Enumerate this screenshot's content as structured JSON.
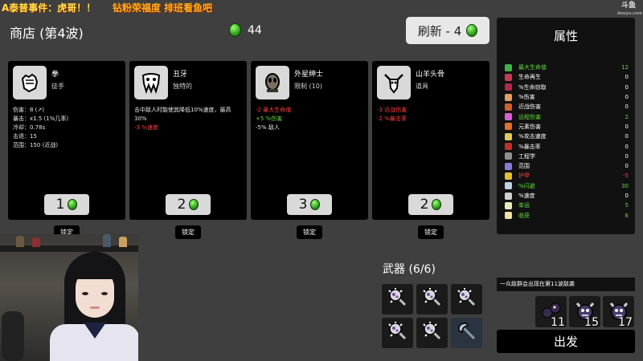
{
  "marquee": {
    "line1": "A泰普事件：虎哥！！",
    "line2": "钻粉荣福度 排班看鱼吧"
  },
  "watermark": {
    "logo": "斗鱼",
    "sub": "douyu.com"
  },
  "shop": {
    "title": "商店 (第4波)",
    "materials": "44"
  },
  "refresh": {
    "label": "刷新 - 4"
  },
  "cards": [
    {
      "name": "拳",
      "type": "徒手",
      "icon": "fist-icon",
      "stats": [
        {
          "text": "伤害：8 (↗)",
          "color": "w"
        },
        {
          "text": "暴击：x1.5 (1%几率)",
          "color": "w"
        },
        {
          "text": "冷却：0.78s",
          "color": "w"
        },
        {
          "text": "击退：15",
          "color": "w"
        },
        {
          "text": "范围：150 (近战)",
          "color": "w"
        }
      ],
      "price": "1",
      "lock": "锁定"
    },
    {
      "name": "丑牙",
      "type": "独特的",
      "icon": "ugly-tooth-icon",
      "stats": [
        {
          "text": "击中敌人时能使其降低10%速度，最高30%",
          "color": "w"
        },
        {
          "text": "-3 %速度",
          "color": "r"
        }
      ],
      "price": "2",
      "lock": "锁定"
    },
    {
      "name": "外星绅士",
      "type": "限制 (10)",
      "icon": "alien-gentleman-icon",
      "stats": [
        {
          "text": "-2 最大生命值",
          "color": "r"
        },
        {
          "text": "+5 %伤害",
          "color": "g"
        },
        {
          "text": "-5% 敌人",
          "color": "w"
        }
      ],
      "price": "3",
      "lock": "锁定"
    },
    {
      "name": "山羊头骨",
      "type": "道具",
      "icon": "goat-skull-icon",
      "stats": [
        {
          "text": "-3 近战伤害",
          "color": "r"
        },
        {
          "text": "-2 %暴击率",
          "color": "r"
        }
      ],
      "price": "2",
      "lock": "锁定"
    }
  ],
  "attributes": {
    "title": "属性",
    "rows": [
      {
        "label": "最大生命值",
        "value": "12",
        "highlight": "#5fdc3a",
        "icon_color": "#3fb34a"
      },
      {
        "label": "生命再生",
        "value": "0",
        "highlight": "#ffffff",
        "icon_color": "#c93a50"
      },
      {
        "label": "%生命窃取",
        "value": "0",
        "highlight": "#ffffff",
        "icon_color": "#b0284a"
      },
      {
        "label": "%伤害",
        "value": "0",
        "highlight": "#ffffff",
        "icon_color": "#e0a060"
      },
      {
        "label": "近战伤害",
        "value": "0",
        "highlight": "#ffffff",
        "icon_color": "#d06030"
      },
      {
        "label": "远程伤害",
        "value": "2",
        "highlight": "#5fdc3a",
        "icon_color": "#d55fd5"
      },
      {
        "label": "元素伤害",
        "value": "0",
        "highlight": "#ffffff",
        "icon_color": "#e07030"
      },
      {
        "label": "%攻击速度",
        "value": "0",
        "highlight": "#ffffff",
        "icon_color": "#e0c860"
      },
      {
        "label": "%暴击率",
        "value": "0",
        "highlight": "#ffffff",
        "icon_color": "#c03030"
      },
      {
        "label": "工程学",
        "value": "0",
        "highlight": "#ffffff",
        "icon_color": "#909090"
      },
      {
        "label": "范围",
        "value": "0",
        "highlight": "#ffffff",
        "icon_color": "#8a7ad8"
      },
      {
        "label": "护甲",
        "value": "-5",
        "highlight": "#ff4040",
        "icon_color": "#e0c030"
      },
      {
        "label": "%闪避",
        "value": "30",
        "highlight": "#5fdc3a",
        "icon_color": "#c0d0e0"
      },
      {
        "label": "%速度",
        "value": "0",
        "highlight": "#ffffff",
        "icon_color": "#d0d0d0"
      },
      {
        "label": "幸运",
        "value": "5",
        "highlight": "#5fdc3a",
        "icon_color": "#e8e8c0"
      },
      {
        "label": "收获",
        "value": "6",
        "highlight": "#5fdc3a",
        "icon_color": "#f0e0a0"
      }
    ]
  },
  "weapons": {
    "title": "武器 (6/6)",
    "slots": [
      {
        "icon": "mace-icon",
        "tier": 1
      },
      {
        "icon": "mace-icon",
        "tier": 1
      },
      {
        "icon": "mace-icon",
        "tier": 1
      },
      {
        "icon": "mace-icon",
        "tier": 1
      },
      {
        "icon": "mace-icon",
        "tier": 1
      },
      {
        "icon": "axe-icon",
        "tier": 2
      }
    ]
  },
  "wave_notice": "一众敌群会出现在第11波敌袭",
  "enemies": [
    {
      "icon": "bomber-enemy-icon",
      "count": "11"
    },
    {
      "icon": "horned-enemy-icon",
      "count": "15"
    },
    {
      "icon": "horned-enemy-icon",
      "count": "17"
    }
  ],
  "go_button": "出发"
}
